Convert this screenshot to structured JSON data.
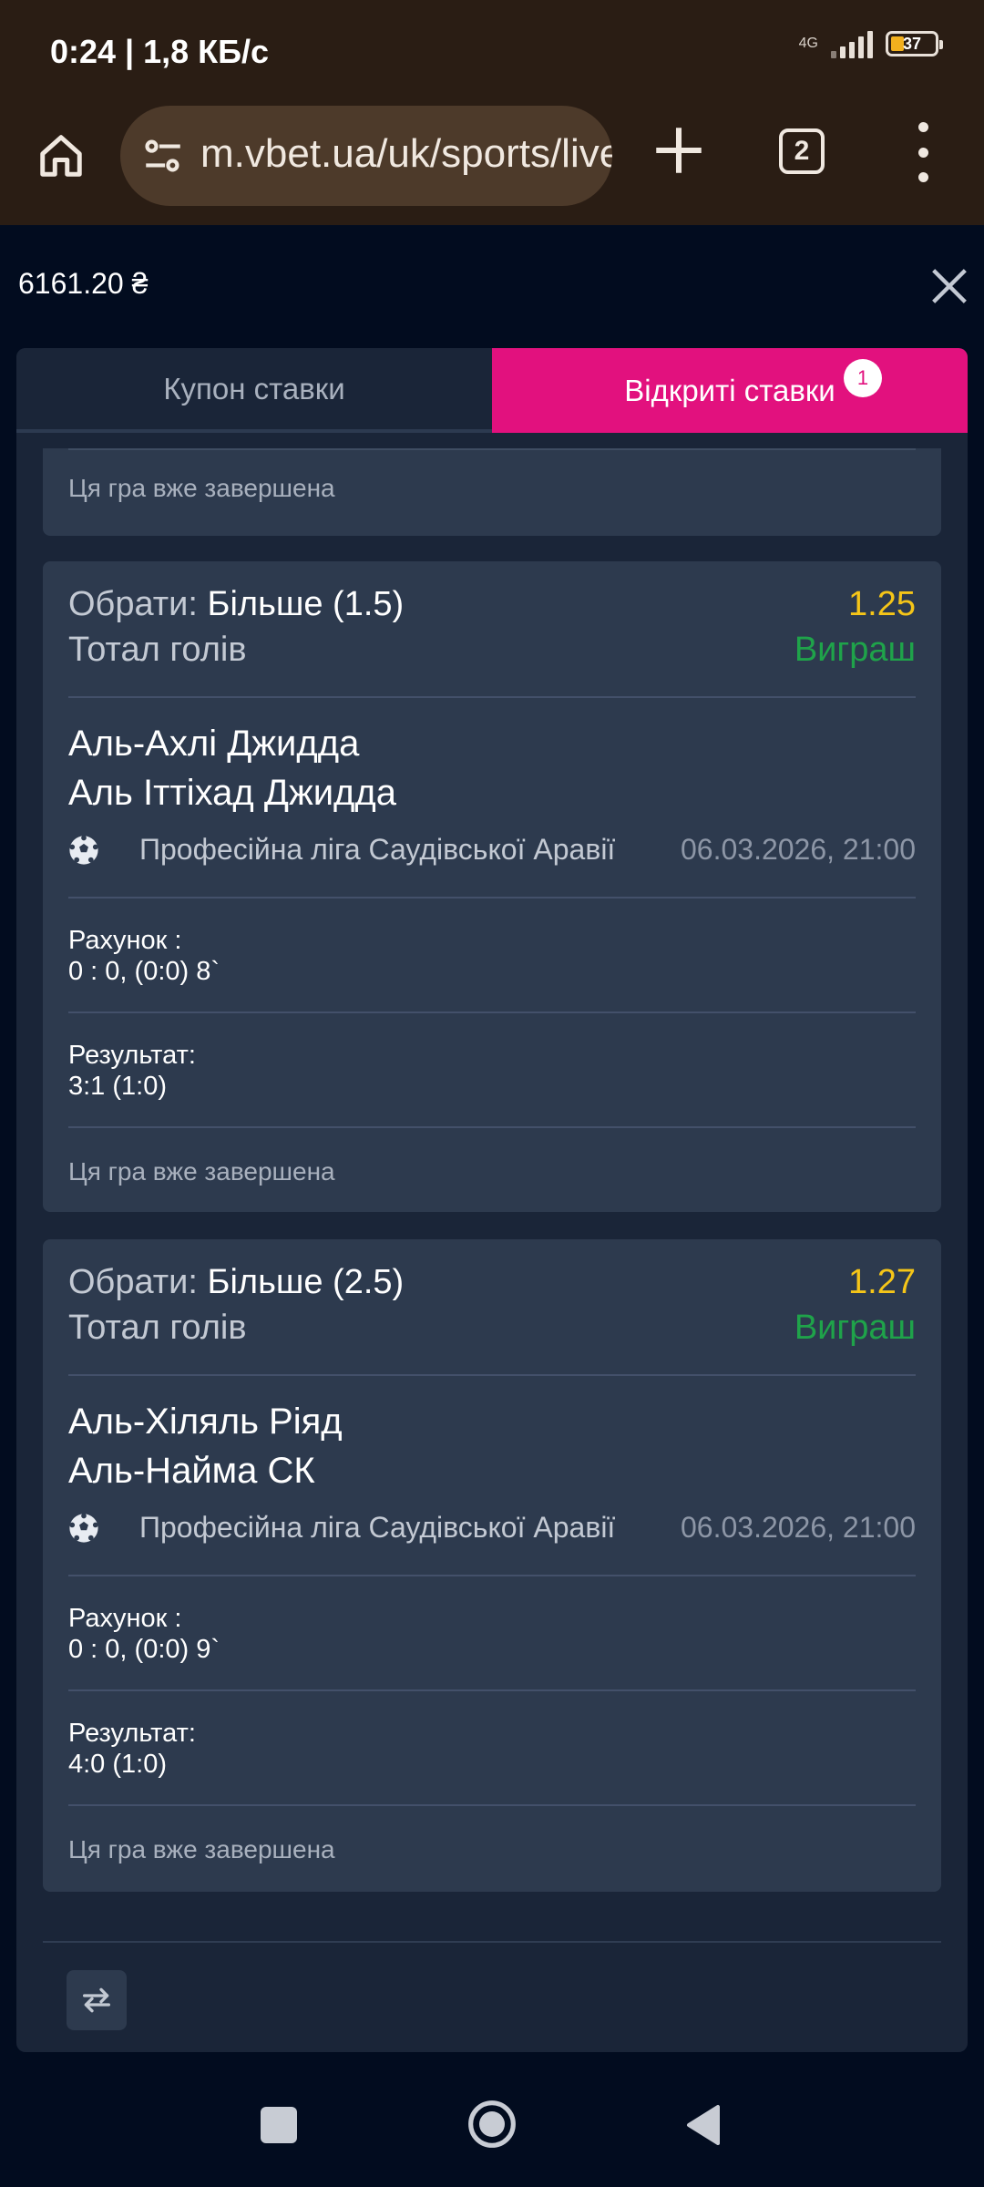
{
  "status_bar": {
    "time": "0:24 | 1,8 КБ/с",
    "network": "4G",
    "battery": "37"
  },
  "browser": {
    "url": "m.vbet.ua/uk/sports/live",
    "tab_count": "2",
    "icons": [
      "home-icon",
      "site-settings-icon",
      "plus-icon",
      "tabs-icon",
      "more-vert-icon"
    ]
  },
  "betslip": {
    "balance": "6161.20 ₴",
    "tabs": {
      "coupon": "Купон ставки",
      "open_bets": "Відкриті ставки",
      "open_bets_badge": "1"
    },
    "top_card_ended": "Ця гра вже завершена",
    "bets": [
      {
        "select_prefix": "Обрати:",
        "select_value": "Більше (1.5)",
        "odds": "1.25",
        "market": "Тотал голів",
        "status": "Виграш",
        "team1": "Аль-Ахлі Джидда",
        "team2": "Аль Іттіхад Джидда",
        "league": "Професійна ліга Саудівської Аравії",
        "datetime": "06.03.2026, 21:00",
        "score_label": "Рахунок :",
        "score_value": "0 : 0, (0:0) 8`",
        "result_label": "Результат:",
        "result_value": "3:1 (1:0)",
        "ended": "Ця гра вже завершена"
      },
      {
        "select_prefix": "Обрати:",
        "select_value": "Більше (2.5)",
        "odds": "1.27",
        "market": "Тотал голів",
        "status": "Виграш",
        "team1": "Аль-Хіляль Ріяд",
        "team2": "Аль-Найма СК",
        "league": "Професійна ліга Саудівської Аравії",
        "datetime": "06.03.2026, 21:00",
        "score_label": "Рахунок :",
        "score_value": "0 : 0, (0:0) 9`",
        "result_label": "Результат:",
        "result_value": "4:0 (1:0)",
        "ended": "Ця гра вже завершена"
      }
    ]
  },
  "colors": {
    "accent": "#e2117e",
    "odds": "#f5c518",
    "win": "#1fa34a",
    "card": "#2d3a4e",
    "panel": "#1a2538",
    "background": "#020c1f"
  }
}
